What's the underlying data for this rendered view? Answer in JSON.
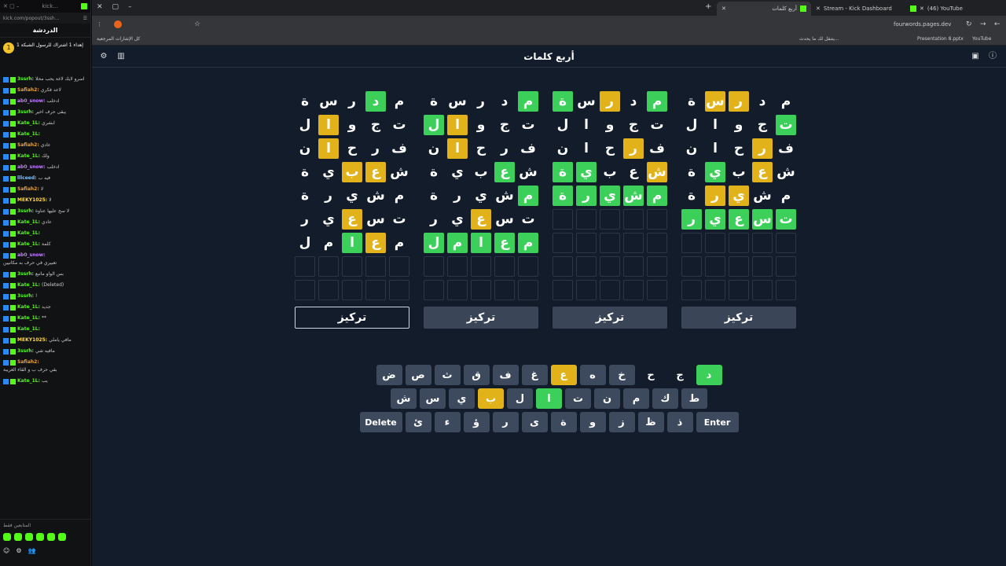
{
  "chat": {
    "window_title": "kick...",
    "url": "kick.com/popout/3ssh...",
    "title": "الدردشة",
    "pinned_text": "إهداء 1 اشتراك للرسول الشبكة 1",
    "messages": [
      {
        "user": "3ssrh",
        "text": "اسرو لايك لاغة يحب محلا",
        "color": "#53fc18"
      },
      {
        "user": "Safiah2",
        "text": "لاعد فكري",
        "color": "#f0a030"
      },
      {
        "user": "ab0_snow",
        "text": "ادخلب",
        "color": "#c080ff"
      },
      {
        "user": "3ssrh",
        "text": "يبقى حرف اخير",
        "color": "#53fc18"
      },
      {
        "user": "Kate_1L",
        "text": "ابشري",
        "color": "#53fc18"
      },
      {
        "user": "Kate_1L",
        "text": "",
        "color": "#53fc18"
      },
      {
        "user": "Safiah2",
        "text": "عادي",
        "color": "#f0a030"
      },
      {
        "user": "Kate_1L",
        "text": "ولك",
        "color": "#53fc18"
      },
      {
        "user": "ab0_snow",
        "text": "ادخلب",
        "color": "#c080ff"
      },
      {
        "user": "lllceed",
        "text": "فيه ب",
        "color": "#80c0ff"
      },
      {
        "user": "Safiah2",
        "text": "لا",
        "color": "#f0a030"
      },
      {
        "user": "MEKY1025",
        "text": "لا",
        "color": "#ffd84a"
      },
      {
        "user": "3ssrh",
        "text": "لا سح عليها عناوة",
        "color": "#53fc18"
      },
      {
        "user": "Kate_1L",
        "text": "عادي",
        "color": "#53fc18"
      },
      {
        "user": "Kate_1L",
        "text": "",
        "color": "#53fc18"
      },
      {
        "user": "Kate_1L",
        "text": "كلمة",
        "color": "#53fc18"
      },
      {
        "user": "ab0_snow",
        "text": "تعبيري في حرف به مكانيين",
        "color": "#c080ff"
      },
      {
        "user": "3ssrh",
        "text": "بس الواو ماتبع",
        "color": "#53fc18"
      },
      {
        "user": "Kate_1L",
        "text": "(Deleted)",
        "color": "#53fc18"
      },
      {
        "user": "3ssrh",
        "text": "!",
        "color": "#53fc18"
      },
      {
        "user": "Kate_1L",
        "text": "جديد",
        "color": "#53fc18"
      },
      {
        "user": "Kate_1L",
        "text": "**",
        "color": "#53fc18"
      },
      {
        "user": "Kate_1L",
        "text": "",
        "color": "#53fc18"
      },
      {
        "user": "MEKY1025",
        "text": "مافي ياملي",
        "color": "#ffd84a"
      },
      {
        "user": "3ssrh",
        "text": "مافيه شي",
        "color": "#53fc18"
      },
      {
        "user": "Safiah2",
        "text": "بقي حرف ب و القاء الغريبة",
        "color": "#f0a030"
      },
      {
        "user": "Kate_1L",
        "text": "يب",
        "color": "#53fc18"
      }
    ],
    "bottom_label": "المتابعين فقط"
  },
  "browser": {
    "tabs": [
      "أربع كلمات",
      "Stream - Kick Dashboard",
      "(46) YouTube"
    ],
    "url": "fourwords.pages.dev",
    "bookmarks": [
      "كل الإشارات المرجعية",
      "يتنقل لك ما يحدث...",
      "Presentation 8.pptx",
      "YouTube"
    ]
  },
  "game": {
    "title": "أربع كلمات",
    "focus_label": "تركيز",
    "boards": [
      {
        "rows": [
          [
            [
              "م",
              "n"
            ],
            [
              "د",
              "g"
            ],
            [
              "ر",
              "n"
            ],
            [
              "س",
              "n"
            ],
            [
              "ة",
              "n"
            ]
          ],
          [
            [
              "ت",
              "n"
            ],
            [
              "ج",
              "n"
            ],
            [
              "و",
              "n"
            ],
            [
              "ا",
              "y"
            ],
            [
              "ل",
              "n"
            ]
          ],
          [
            [
              "ف",
              "n"
            ],
            [
              "ر",
              "n"
            ],
            [
              "ح",
              "n"
            ],
            [
              "ا",
              "y"
            ],
            [
              "ن",
              "n"
            ]
          ],
          [
            [
              "ش",
              "n"
            ],
            [
              "ع",
              "y"
            ],
            [
              "ب",
              "y"
            ],
            [
              "ي",
              "n"
            ],
            [
              "ة",
              "n"
            ]
          ],
          [
            [
              "م",
              "n"
            ],
            [
              "ش",
              "n"
            ],
            [
              "ي",
              "n"
            ],
            [
              "ر",
              "n"
            ],
            [
              "ة",
              "n"
            ]
          ],
          [
            [
              "ت",
              "n"
            ],
            [
              "س",
              "n"
            ],
            [
              "ع",
              "y"
            ],
            [
              "ي",
              "n"
            ],
            [
              "ر",
              "n"
            ]
          ],
          [
            [
              "م",
              "n"
            ],
            [
              "ع",
              "y"
            ],
            [
              "ا",
              "g"
            ],
            [
              "م",
              "n"
            ],
            [
              "ل",
              "n"
            ]
          ]
        ],
        "selected": true
      },
      {
        "rows": [
          [
            [
              "م",
              "g"
            ],
            [
              "د",
              "n"
            ],
            [
              "ر",
              "n"
            ],
            [
              "س",
              "n"
            ],
            [
              "ة",
              "n"
            ]
          ],
          [
            [
              "ت",
              "n"
            ],
            [
              "ج",
              "n"
            ],
            [
              "و",
              "n"
            ],
            [
              "ا",
              "y"
            ],
            [
              "ل",
              "g"
            ]
          ],
          [
            [
              "ف",
              "n"
            ],
            [
              "ر",
              "n"
            ],
            [
              "ح",
              "n"
            ],
            [
              "ا",
              "y"
            ],
            [
              "ن",
              "n"
            ]
          ],
          [
            [
              "ش",
              "n"
            ],
            [
              "ع",
              "g"
            ],
            [
              "ب",
              "n"
            ],
            [
              "ي",
              "n"
            ],
            [
              "ة",
              "n"
            ]
          ],
          [
            [
              "م",
              "g"
            ],
            [
              "ش",
              "n"
            ],
            [
              "ي",
              "n"
            ],
            [
              "ر",
              "n"
            ],
            [
              "ة",
              "n"
            ]
          ],
          [
            [
              "ت",
              "n"
            ],
            [
              "س",
              "n"
            ],
            [
              "ع",
              "y"
            ],
            [
              "ي",
              "n"
            ],
            [
              "ر",
              "n"
            ]
          ],
          [
            [
              "م",
              "g"
            ],
            [
              "ع",
              "g"
            ],
            [
              "ا",
              "g"
            ],
            [
              "م",
              "g"
            ],
            [
              "ل",
              "g"
            ]
          ]
        ],
        "selected": false
      },
      {
        "rows": [
          [
            [
              "م",
              "g"
            ],
            [
              "د",
              "n"
            ],
            [
              "ر",
              "y"
            ],
            [
              "س",
              "n"
            ],
            [
              "ة",
              "g"
            ]
          ],
          [
            [
              "ت",
              "n"
            ],
            [
              "ج",
              "n"
            ],
            [
              "و",
              "n"
            ],
            [
              "ا",
              "n"
            ],
            [
              "ل",
              "n"
            ]
          ],
          [
            [
              "ف",
              "n"
            ],
            [
              "ر",
              "y"
            ],
            [
              "ح",
              "n"
            ],
            [
              "ا",
              "n"
            ],
            [
              "ن",
              "n"
            ]
          ],
          [
            [
              "ش",
              "y"
            ],
            [
              "ع",
              "n"
            ],
            [
              "ب",
              "n"
            ],
            [
              "ي",
              "g"
            ],
            [
              "ة",
              "g"
            ]
          ],
          [
            [
              "م",
              "g"
            ],
            [
              "ش",
              "g"
            ],
            [
              "ي",
              "g"
            ],
            [
              "ر",
              "g"
            ],
            [
              "ة",
              "g"
            ]
          ]
        ],
        "selected": false
      },
      {
        "rows": [
          [
            [
              "م",
              "n"
            ],
            [
              "د",
              "n"
            ],
            [
              "ر",
              "y"
            ],
            [
              "س",
              "y"
            ],
            [
              "ة",
              "n"
            ]
          ],
          [
            [
              "ت",
              "g"
            ],
            [
              "ج",
              "n"
            ],
            [
              "و",
              "n"
            ],
            [
              "ا",
              "n"
            ],
            [
              "ل",
              "n"
            ]
          ],
          [
            [
              "ف",
              "n"
            ],
            [
              "ر",
              "y"
            ],
            [
              "ح",
              "n"
            ],
            [
              "ا",
              "n"
            ],
            [
              "ن",
              "n"
            ]
          ],
          [
            [
              "ش",
              "n"
            ],
            [
              "ع",
              "y"
            ],
            [
              "ب",
              "n"
            ],
            [
              "ي",
              "g"
            ],
            [
              "ة",
              "n"
            ]
          ],
          [
            [
              "م",
              "n"
            ],
            [
              "ش",
              "n"
            ],
            [
              "ي",
              "y"
            ],
            [
              "ر",
              "y"
            ],
            [
              "ة",
              "n"
            ]
          ],
          [
            [
              "ت",
              "g"
            ],
            [
              "س",
              "g"
            ],
            [
              "ع",
              "g"
            ],
            [
              "ي",
              "g"
            ],
            [
              "ر",
              "g"
            ]
          ]
        ],
        "selected": false
      }
    ],
    "keyboard": [
      [
        [
          "د",
          "g"
        ],
        [
          "ج",
          "k"
        ],
        [
          "ح",
          "k"
        ],
        [
          "خ",
          "n"
        ],
        [
          "ه",
          "n"
        ],
        [
          "ع",
          "y"
        ],
        [
          "غ",
          "n"
        ],
        [
          "ف",
          "n"
        ],
        [
          "ق",
          "n"
        ],
        [
          "ث",
          "n"
        ],
        [
          "ص",
          "n"
        ],
        [
          "ض",
          "n"
        ]
      ],
      [
        [
          "ط",
          "n"
        ],
        [
          "ك",
          "n"
        ],
        [
          "م",
          "n"
        ],
        [
          "ن",
          "n"
        ],
        [
          "ت",
          "n"
        ],
        [
          "ا",
          "g"
        ],
        [
          "ل",
          "n"
        ],
        [
          "ب",
          "y"
        ],
        [
          "ي",
          "n"
        ],
        [
          "س",
          "n"
        ],
        [
          "ش",
          "n"
        ]
      ],
      [
        [
          "Enter",
          "w"
        ],
        [
          "ذ",
          "n"
        ],
        [
          "ظ",
          "n"
        ],
        [
          "ز",
          "n"
        ],
        [
          "و",
          "n"
        ],
        [
          "ة",
          "n"
        ],
        [
          "ى",
          "n"
        ],
        [
          "ر",
          "n"
        ],
        [
          "ؤ",
          "n"
        ],
        [
          "ء",
          "n"
        ],
        [
          "ئ",
          "n"
        ],
        [
          "Delete",
          "w"
        ]
      ]
    ]
  }
}
